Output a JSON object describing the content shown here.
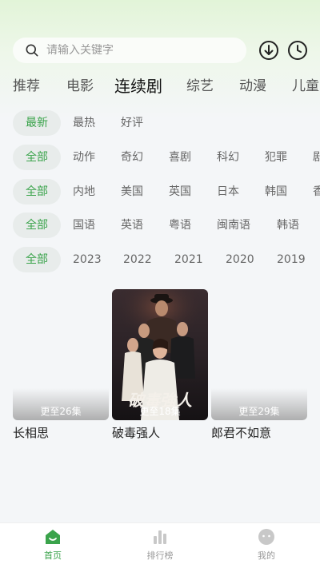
{
  "search": {
    "placeholder": "请输入关键字"
  },
  "icons": {
    "search": "search-icon",
    "download": "download-icon",
    "history": "clock-icon"
  },
  "category_tabs": [
    {
      "label": "推荐"
    },
    {
      "label": "电影"
    },
    {
      "label": "连续剧",
      "active": true
    },
    {
      "label": "综艺"
    },
    {
      "label": "动漫"
    },
    {
      "label": "儿童"
    }
  ],
  "filters": {
    "sort": [
      "最新",
      "最热",
      "好评"
    ],
    "genre": [
      "全部",
      "动作",
      "奇幻",
      "喜剧",
      "科幻",
      "犯罪",
      "剧"
    ],
    "region": [
      "全部",
      "内地",
      "美国",
      "英国",
      "日本",
      "韩国",
      "香"
    ],
    "language": [
      "全部",
      "国语",
      "英语",
      "粤语",
      "闽南语",
      "韩语"
    ],
    "year": [
      "全部",
      "2023",
      "2022",
      "2021",
      "2020",
      "2019"
    ]
  },
  "shows": [
    {
      "title": "长相思",
      "episodes": "更至26集"
    },
    {
      "title": "破毒强人",
      "episodes": "更至18集",
      "poster_text": "破毒強人"
    },
    {
      "title": "郎君不如意",
      "episodes": "更至29集"
    }
  ],
  "bottom_nav": [
    {
      "label": "首页",
      "active": true
    },
    {
      "label": "排行榜"
    },
    {
      "label": "我的"
    }
  ],
  "colors": {
    "accent": "#3aa34b",
    "chip_bg": "#e8eceb",
    "background": "#f4f6f8"
  }
}
